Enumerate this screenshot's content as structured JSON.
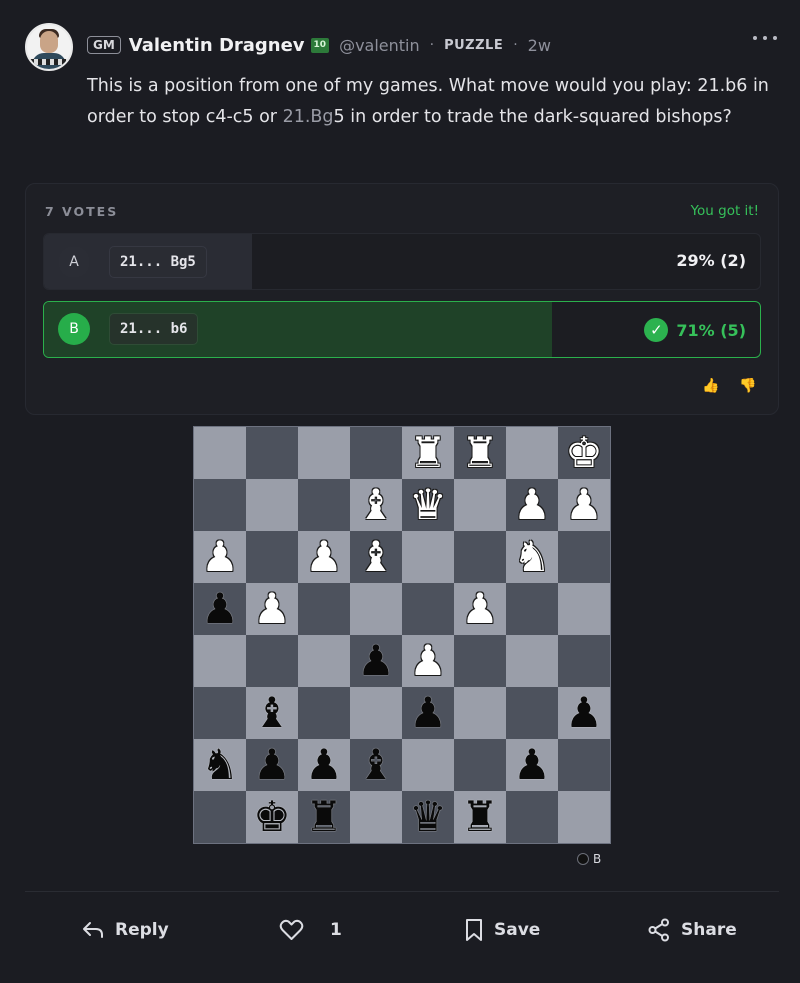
{
  "post": {
    "author": {
      "title": "GM",
      "name": "Valentin Dragnev",
      "rating_badge": "10",
      "handle": "@valentin"
    },
    "tag": "PUZZLE",
    "time": "2w",
    "text_before": "This is a position from one of my games. What move would you play: 21.b6 in order to stop c4-c5 or ",
    "text_highlight": "21.Bg",
    "text_after": "5 in order to trade the dark-squared bishops?"
  },
  "poll": {
    "votes_label": "7 VOTES",
    "status": "You got it!",
    "options": [
      {
        "letter": "A",
        "move": "21... Bg5",
        "result": "29% (2)",
        "percent": 29,
        "correct": false
      },
      {
        "letter": "B",
        "move": "21... b6",
        "result": "71% (5)",
        "percent": 71,
        "correct": true
      }
    ],
    "reactions": {
      "like": "👍",
      "dislike": "👎"
    }
  },
  "board": {
    "rows": [
      [
        "",
        "",
        "",
        "",
        "wR",
        "wR",
        "",
        "wK"
      ],
      [
        "",
        "",
        "",
        "wB",
        "wQ",
        "",
        "wP",
        "wP"
      ],
      [
        "wP",
        "",
        "wP",
        "wB",
        "",
        "",
        "wN",
        ""
      ],
      [
        "bP",
        "wP",
        "",
        "",
        "",
        "wP",
        "",
        ""
      ],
      [
        "",
        "",
        "",
        "bP",
        "wP",
        "",
        "",
        ""
      ],
      [
        "",
        "bB",
        "",
        "",
        "bP",
        "",
        "",
        "bP"
      ],
      [
        "bN",
        "bP",
        "bP",
        "bB",
        "",
        "",
        "bP",
        ""
      ],
      [
        "",
        "bK",
        "bR",
        "",
        "bQ",
        "bR",
        "",
        ""
      ]
    ],
    "to_move": "B",
    "light_color": "#9a9ea9",
    "dark_color": "#4d525d"
  },
  "actions": {
    "reply": "Reply",
    "like_count": "1",
    "save": "Save",
    "share": "Share"
  },
  "colors": {
    "accent_green": "#36c05a",
    "background": "#1b1c22"
  }
}
